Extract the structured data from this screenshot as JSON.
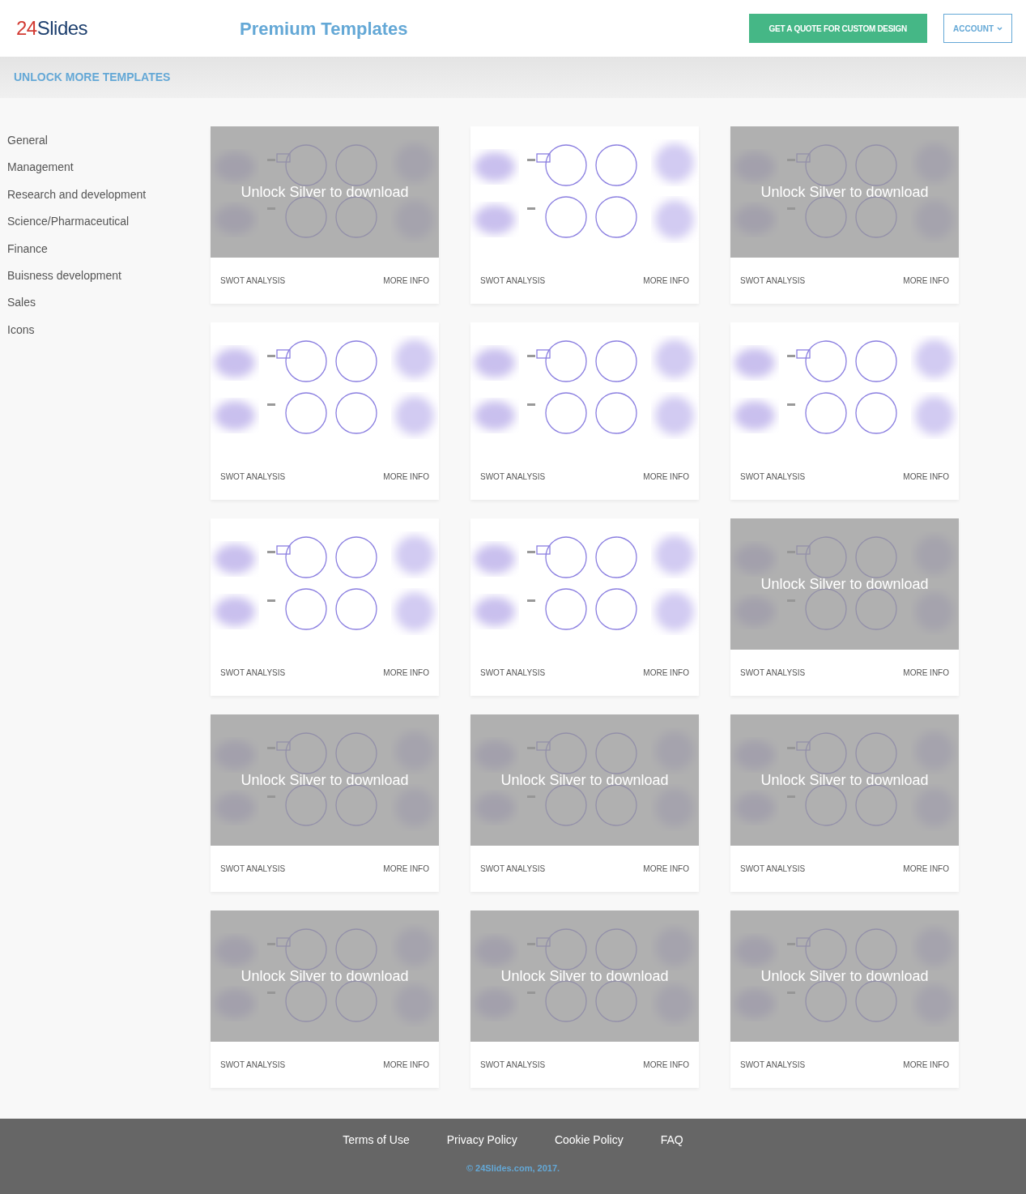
{
  "header": {
    "logo_digits": "24",
    "logo_word": "Slides",
    "title": "Premium Templates",
    "quote_button": "GET A QUOTE FOR CUSTOM DESIGN",
    "account_button": "ACCOUNT"
  },
  "subheader": {
    "title": "UNLOCK MORE TEMPLATES"
  },
  "sidebar": {
    "items": [
      {
        "label": "General"
      },
      {
        "label": "Management"
      },
      {
        "label": "Research and development"
      },
      {
        "label": "Science/Pharmaceutical"
      },
      {
        "label": "Finance"
      },
      {
        "label": "Buisness development"
      },
      {
        "label": "Sales"
      },
      {
        "label": "Icons"
      }
    ]
  },
  "template_rows": [
    {
      "templates": [
        {
          "kind": "picture",
          "locked": true,
          "lock_text": "Unlock Silver to download",
          "name": "SWOT ANALYSIS",
          "link": "MORE INFO"
        },
        {
          "kind": "picture",
          "locked": false,
          "name": "SWOT ANALYSIS",
          "link": "MORE INFO"
        },
        {
          "kind": "picture",
          "locked": true,
          "lock_text": "Unlock Silver to download",
          "name": "SWOT ANALYSIS",
          "link": "MORE INFO"
        }
      ]
    },
    {
      "templates": [
        {
          "kind": "picture",
          "locked": false,
          "name": "SWOT ANALYSIS",
          "link": "MORE INFO"
        },
        {
          "kind": "picture",
          "locked": false,
          "name": "SWOT ANALYSIS",
          "link": "MORE INFO"
        },
        {
          "kind": "picture",
          "locked": false,
          "name": "SWOT ANALYSIS",
          "link": "MORE INFO"
        }
      ]
    },
    {
      "templates": [
        {
          "kind": "picture",
          "locked": false,
          "name": "SWOT ANALYSIS",
          "link": "MORE INFO"
        },
        {
          "kind": "picture",
          "locked": false,
          "name": "SWOT ANALYSIS",
          "link": "MORE INFO"
        },
        {
          "kind": "picture",
          "locked": true,
          "lock_text": "Unlock Silver to download",
          "name": "SWOT ANALYSIS",
          "link": "MORE INFO"
        }
      ]
    },
    {
      "templates": [
        {
          "kind": "picture",
          "locked": true,
          "lock_text": "Unlock Silver to download",
          "name": "SWOT ANALYSIS",
          "link": "MORE INFO"
        },
        {
          "kind": "picture",
          "locked": true,
          "lock_text": "Unlock Silver to download",
          "name": "SWOT ANALYSIS",
          "link": "MORE INFO"
        },
        {
          "kind": "picture",
          "locked": true,
          "lock_text": "Unlock Silver to download",
          "name": "SWOT ANALYSIS",
          "link": "MORE INFO"
        }
      ]
    },
    {
      "templates": [
        {
          "kind": "picture",
          "locked": true,
          "lock_text": "Unlock Silver to download",
          "name": "SWOT ANALYSIS",
          "link": "MORE INFO"
        },
        {
          "kind": "picture",
          "locked": true,
          "lock_text": "Unlock Silver to download",
          "name": "SWOT ANALYSIS",
          "link": "MORE INFO"
        },
        {
          "kind": "picture",
          "locked": true,
          "lock_text": "Unlock Silver to download",
          "name": "SWOT ANALYSIS",
          "link": "MORE INFO"
        }
      ]
    }
  ],
  "footer": {
    "links": [
      "Terms of Use",
      "Privacy Policy",
      "Cookie Policy",
      "FAQ"
    ],
    "copyright": "© 24Slides.com, 2017."
  }
}
